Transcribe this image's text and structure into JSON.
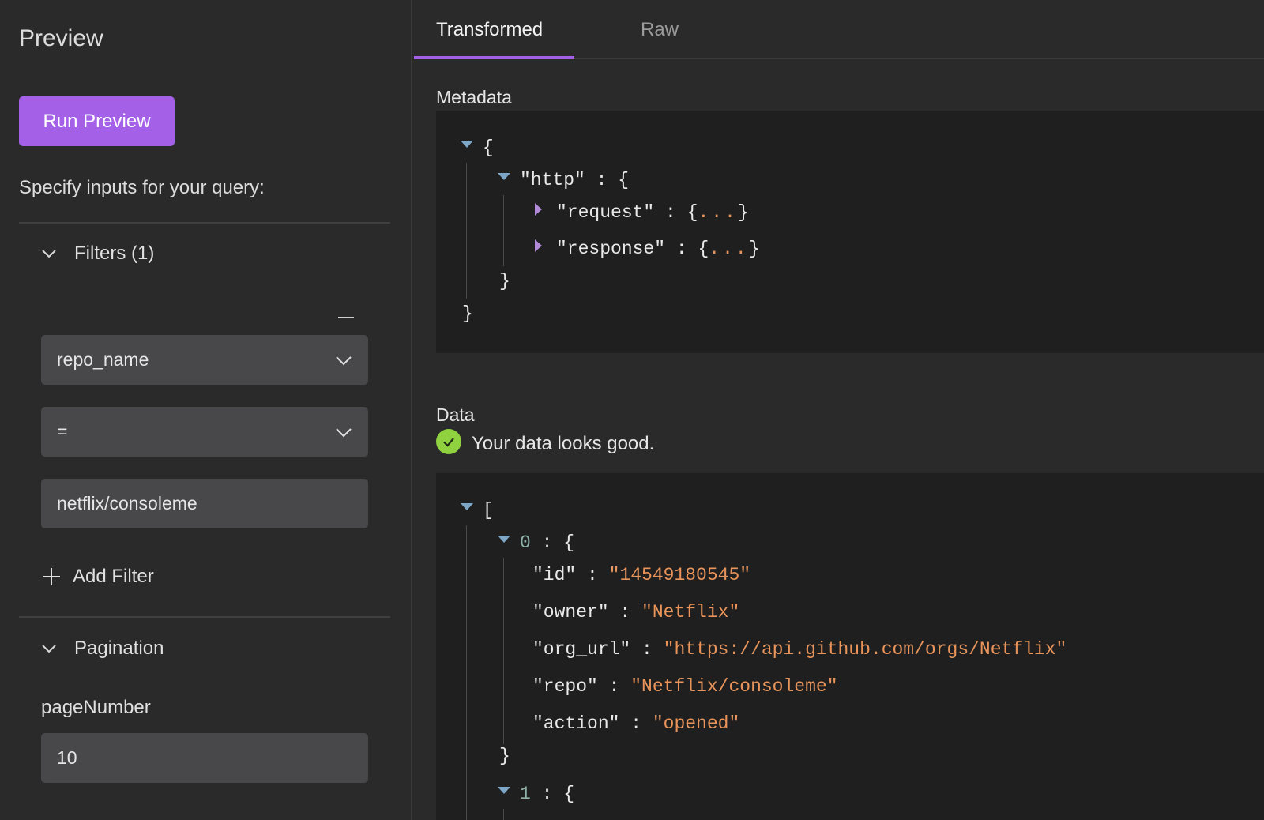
{
  "left": {
    "title": "Preview",
    "run_button": "Run Preview",
    "specify": "Specify inputs for your query:",
    "filters": {
      "header": "Filters (1)",
      "field": "repo_name",
      "operator": "=",
      "value": "netflix/consoleme",
      "add_label": "Add Filter"
    },
    "pagination": {
      "header": "Pagination",
      "label": "pageNumber",
      "value": "10"
    }
  },
  "right": {
    "tabs": [
      "Transformed",
      "Raw"
    ],
    "active_tab": "Transformed",
    "metadata": {
      "label": "Metadata",
      "root_open": "{",
      "root_close": "}",
      "http_key": "\"http\"",
      "sep": " : ",
      "http_open": "{",
      "http_close": "}",
      "request_key": "\"request\"",
      "response_key": "\"response\"",
      "collapsed_open": "{",
      "collapsed_dots": "...",
      "collapsed_close": "}"
    },
    "data": {
      "label": "Data",
      "status": "Your data looks good.",
      "root_open": "[",
      "item0_index": "0",
      "item1_index": "1",
      "obj_open": "{",
      "obj_close": "}",
      "sep": " : ",
      "fields": [
        {
          "key": "\"id\"",
          "value": "\"14549180545\""
        },
        {
          "key": "\"owner\"",
          "value": "\"Netflix\""
        },
        {
          "key": "\"org_url\"",
          "value": "\"https://api.github.com/orgs/Netflix\""
        },
        {
          "key": "\"repo\"",
          "value": "\"Netflix/consoleme\""
        },
        {
          "key": "\"action\"",
          "value": "\"opened\""
        }
      ]
    }
  },
  "colors": {
    "accent": "#a461e8",
    "success": "#8fd13f",
    "string": "#e8945a",
    "index": "#8fb3a9",
    "background": "#2a2a2b",
    "code_background": "#1f1f20"
  },
  "icons": [
    "chevron-down-icon",
    "minus-icon",
    "plus-icon",
    "check-circle-icon",
    "caret-down-icon",
    "caret-right-icon"
  ]
}
